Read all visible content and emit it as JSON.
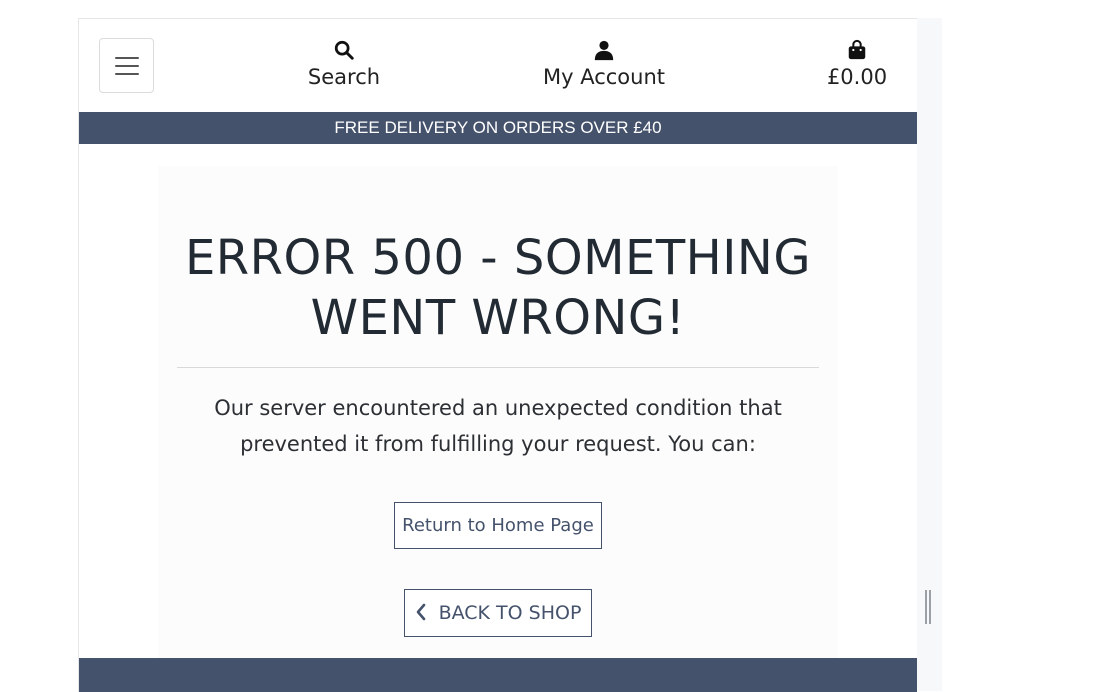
{
  "header": {
    "menu_toggle": "menu",
    "search_label": "Search",
    "account_label": "My Account",
    "bag_total": "£0.00"
  },
  "icons": {
    "search": "search-icon",
    "account": "user-icon",
    "bag": "shopping-bag-icon",
    "menu": "hamburger-icon",
    "chevron": "chevron-left-icon"
  },
  "banner": {
    "text": "FREE DELIVERY ON ORDERS OVER £40"
  },
  "error": {
    "title_line1": "ERROR 500 - SOMETHING",
    "title_line2": "WENT WRONG!",
    "message_line1": "Our server encountered an unexpected condition that",
    "message_line2": "prevented it from fulfilling your request. You can:"
  },
  "actions": {
    "home_label": "Return to Home Page",
    "shop_label": "BACK TO SHOP"
  },
  "colors": {
    "brand": "#45526c",
    "text": "#222a33"
  }
}
